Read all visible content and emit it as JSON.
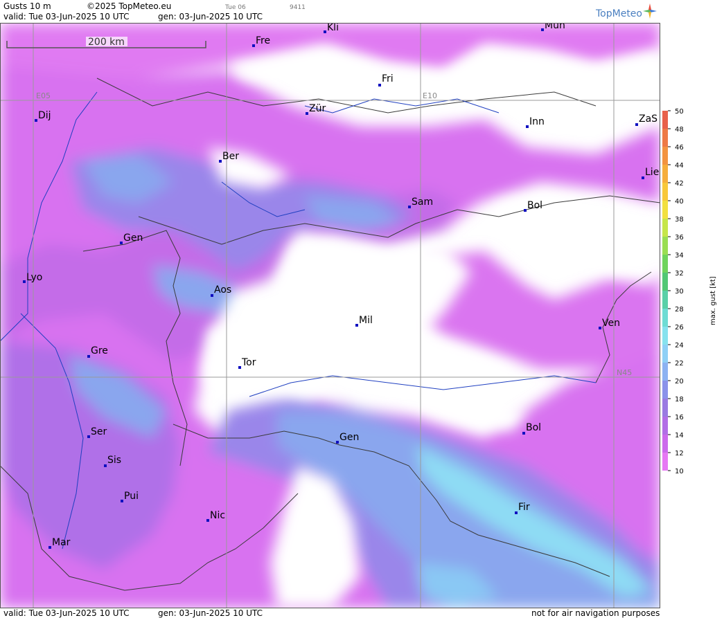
{
  "header": {
    "product": "Gusts 10 m",
    "copyright": "©2025 TopMeteo.eu",
    "day_tag": "Tue 06",
    "code": "9411",
    "valid_line": "valid:  Tue  03-Jun-2025  10 UTC",
    "gen_line": "gen: 03-Jun-2025 10 UTC",
    "logo_text": "TopMeteo"
  },
  "footer": {
    "valid_line": "valid:  Tue  03-Jun-2025  10 UTC",
    "gen_line": "gen: 03-Jun-2025 10 UTC",
    "notice": "not for air navigation purposes"
  },
  "map": {
    "scale_label": "200 km",
    "grid_labels": [
      "E05",
      "E10",
      "N45"
    ],
    "cities": [
      "Kli",
      "Mün",
      "Fre",
      "Fri",
      "Dij",
      "Zür",
      "Inn",
      "ZaS",
      "Ber",
      "Lie",
      "Sam",
      "Bol",
      "Gen",
      "Lyo",
      "Aos",
      "Mil",
      "Ven",
      "Gre",
      "Tor",
      "Gen",
      "Bol",
      "Ser",
      "Sis",
      "Pui",
      "Fir",
      "Nic",
      "Mar"
    ]
  },
  "legend": {
    "axis_label": "max. gust [kt]",
    "ticks": [
      "50",
      "48",
      "46",
      "44",
      "42",
      "40",
      "38",
      "36",
      "34",
      "32",
      "30",
      "28",
      "26",
      "24",
      "22",
      "20",
      "18",
      "16",
      "14",
      "12",
      "10"
    ],
    "colors": {
      "50": "#e8604a",
      "48": "#ee7a45",
      "46": "#f39440",
      "44": "#f6ae3c",
      "42": "#f8c83a",
      "40": "#f2e040",
      "38": "#c6e64a",
      "36": "#9ade52",
      "34": "#6fd45c",
      "32": "#52c874",
      "30": "#5ad0a8",
      "28": "#6edcd4",
      "26": "#86e2ee",
      "24": "#8ed0f6",
      "22": "#8cb2f2",
      "20": "#8a92ea",
      "18": "#9a7ae2",
      "16": "#b26ee6",
      "14": "#cc6aec",
      "12": "#e678f4"
    }
  }
}
